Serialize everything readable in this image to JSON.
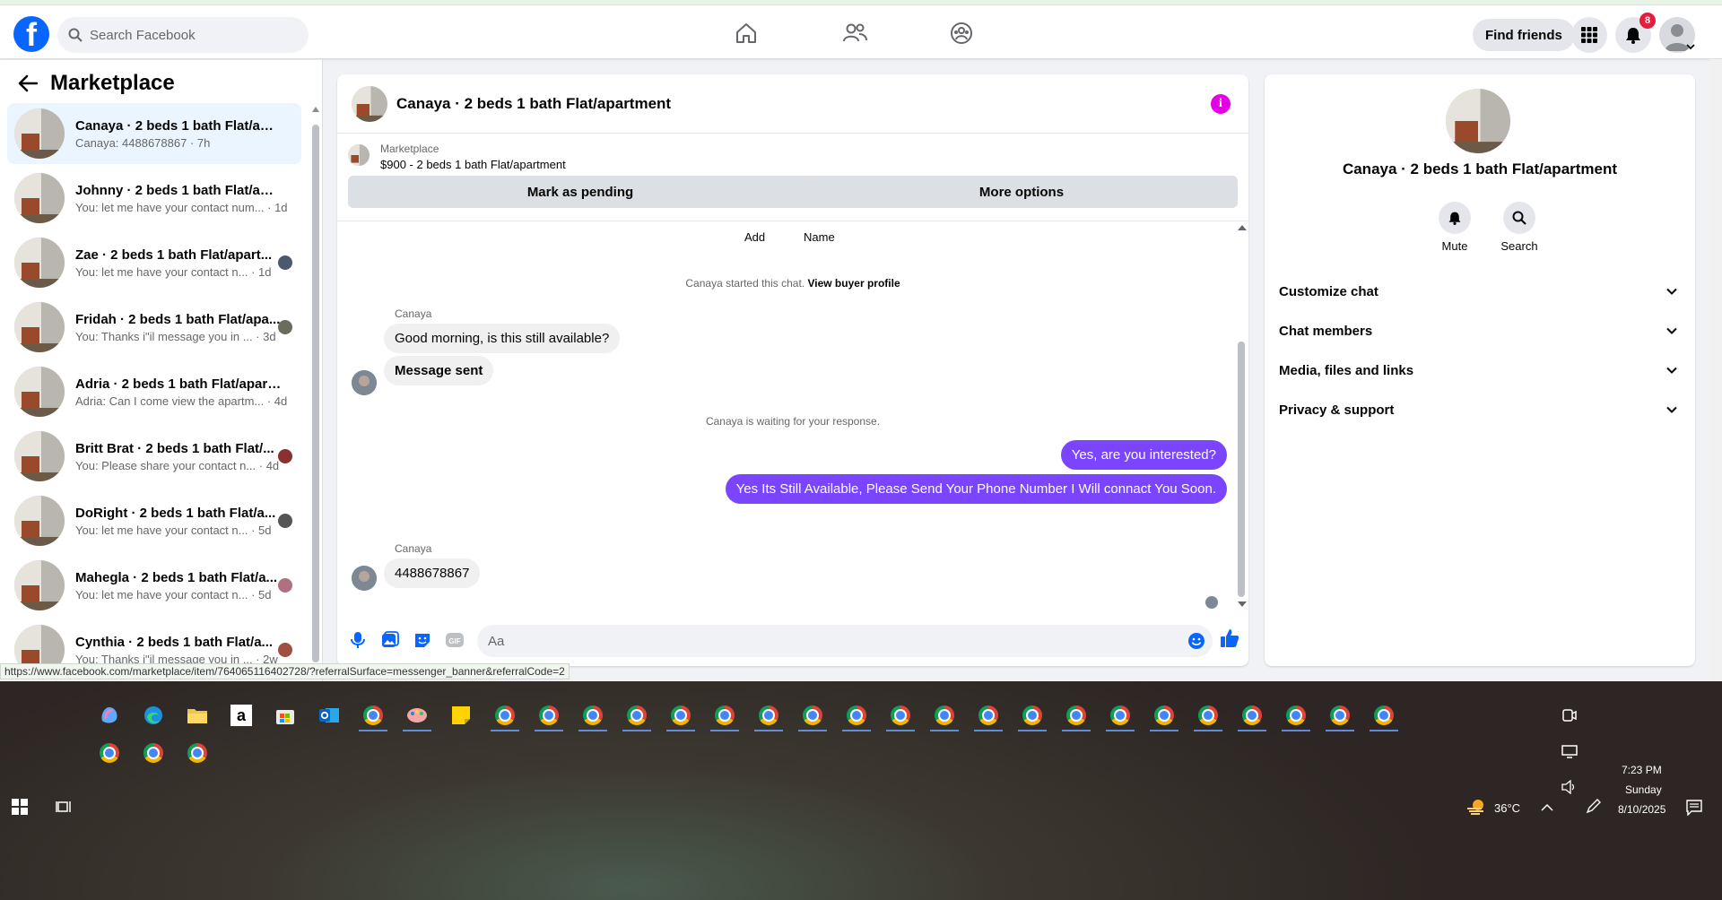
{
  "topbar": {
    "search_placeholder": "Search Facebook",
    "find_friends": "Find friends",
    "notif_count": "8"
  },
  "sidebar": {
    "title": "Marketplace",
    "conversations": [
      {
        "name": "Canaya · 2 beds 1 bath Flat/apar...",
        "preview": "Canaya: 4488678867 · 7h",
        "active": true
      },
      {
        "name": "Johnny · 2 beds 1 bath Flat/apar...",
        "preview": "You: let me have your contact num... · 1d"
      },
      {
        "name": "Zae · 2 beds 1 bath Flat/apart...",
        "preview": "You: let me have your contact n... · 1d"
      },
      {
        "name": "Fridah · 2 beds 1 bath Flat/apa...",
        "preview": "You: Thanks i\"il message you in ... · 3d"
      },
      {
        "name": "Adria · 2 beds 1 bath Flat/apart...",
        "preview": "Adria: Can I come view the apartm... · 4d"
      },
      {
        "name": "Britt Brat · 2 beds 1 bath Flat/...",
        "preview": "You: Please share your contact n... · 4d"
      },
      {
        "name": "DoRight · 2 beds 1 bath Flat/a...",
        "preview": "You: let me have your contact n... · 5d"
      },
      {
        "name": "Mahegla · 2 beds 1 bath Flat/a...",
        "preview": "You: let me have your contact n... · 5d"
      },
      {
        "name": "Cynthia · 2 beds 1 bath Flat/a...",
        "preview": "You: Thanks i\"il message you in ... · 2w"
      }
    ]
  },
  "chat": {
    "title": "Canaya · 2 beds 1 bath Flat/apartment",
    "banner_label": "Marketplace",
    "banner_item": "$900 - 2 beds 1 bath Flat/apartment",
    "btn_pending": "Mark as pending",
    "btn_more": "More options",
    "add": "Add",
    "name": "Name",
    "started_text": "Canaya started this chat.",
    "view_profile": "View buyer profile",
    "sender": "Canaya",
    "msg1": "Good morning, is this still available?",
    "msg2": "Message sent",
    "waiting": "Canaya is waiting for your response.",
    "out1": "Yes, are you interested?",
    "out2": "Yes Its Still Available, Please Send Your Phone Number I Will connact You Soon.",
    "msg3": "4488678867",
    "composer_placeholder": "Aa"
  },
  "details": {
    "title": "Canaya · 2 beds 1 bath Flat/apartment",
    "mute": "Mute",
    "search": "Search",
    "sections": [
      "Customize chat",
      "Chat members",
      "Media, files and links",
      "Privacy & support"
    ]
  },
  "status_url": "https://www.facebook.com/marketplace/item/764065116402728/?referralSurface=messenger_banner&referralCode=2",
  "taskbar": {
    "temp": "36°C",
    "time": "7:23 PM",
    "day": "Sunday",
    "date": "8/10/2025"
  },
  "colors": {
    "brand": "#0866ff",
    "outgoing": "#7b45ff",
    "badge": "#e41e3f"
  }
}
